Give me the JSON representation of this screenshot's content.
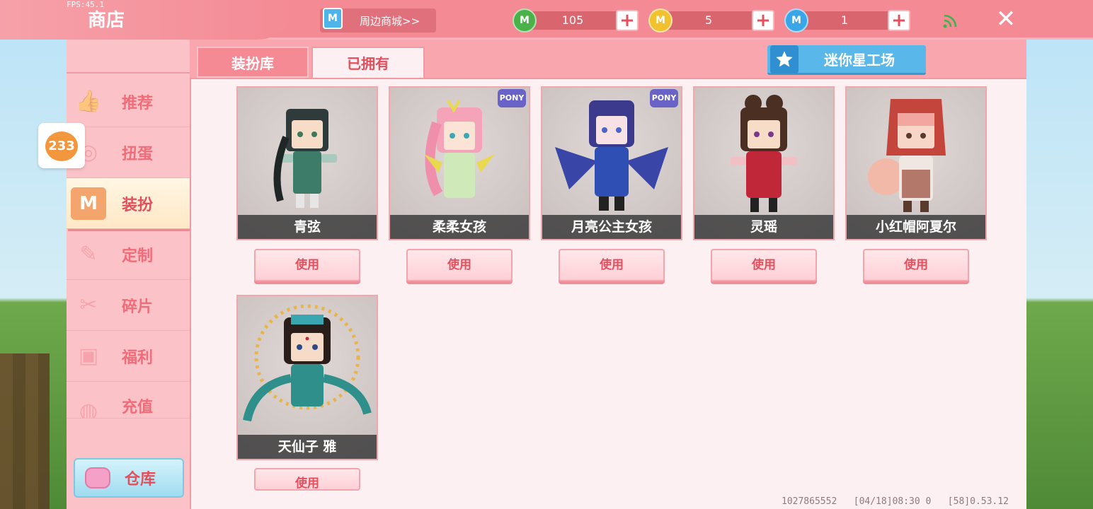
{
  "fps": "FPS:45.1",
  "header": {
    "title": "商店",
    "mall_label": "周边商城>>",
    "currencies": [
      {
        "name": "mini-coin-green",
        "value": "105",
        "color": "#4bb24a",
        "glyph": "M"
      },
      {
        "name": "mini-bean-gold",
        "value": "5",
        "color": "#f2c12e",
        "glyph": "M"
      },
      {
        "name": "mini-point-blue",
        "value": "1",
        "color": "#3aa6e8",
        "glyph": "M"
      }
    ],
    "close_glyph": "✕"
  },
  "badge": {
    "count": "233"
  },
  "sidebar": {
    "items": [
      {
        "label": "推荐",
        "icon": "thumbs-up-icon"
      },
      {
        "label": "扭蛋",
        "icon": "gacha-icon"
      },
      {
        "label": "装扮",
        "icon": "shirt-icon",
        "active": true
      },
      {
        "label": "定制",
        "icon": "pencil-ruler-icon"
      },
      {
        "label": "碎片",
        "icon": "fragment-icon"
      },
      {
        "label": "福利",
        "icon": "gift-icon"
      },
      {
        "label": "充值",
        "icon": "coins-icon"
      }
    ],
    "warehouse_label": "仓库"
  },
  "tabs": {
    "wardrobe": "装扮库",
    "owned": "已拥有",
    "active": "owned"
  },
  "studio_label": "迷你星工场",
  "skins": [
    {
      "name": "青弦",
      "use_label": "使用",
      "pony": false,
      "hair": "#2f3b3a",
      "outfit": "#3e7c6a"
    },
    {
      "name": "柔柔女孩",
      "use_label": "使用",
      "pony": true,
      "hair": "#f4a3b8",
      "outfit": "#cfe9b8"
    },
    {
      "name": "月亮公主女孩",
      "use_label": "使用",
      "pony": true,
      "hair": "#3b3a8c",
      "outfit": "#2f4fb5"
    },
    {
      "name": "灵瑶",
      "use_label": "使用",
      "pony": false,
      "hair": "#4a2f22",
      "outfit": "#c0283a"
    },
    {
      "name": "小红帽阿夏尔",
      "use_label": "使用",
      "pony": false,
      "hair": "#f3a6a0",
      "outfit": "#c3453b"
    },
    {
      "name": "天仙子 雅",
      "use_label": "使用",
      "pony": false,
      "hair": "#2a1e1a",
      "outfit": "#2f8f8a"
    }
  ],
  "pony_tag": "PONY",
  "footer": "1027865552   [04/18]08:30 0   [58]0.53.12"
}
